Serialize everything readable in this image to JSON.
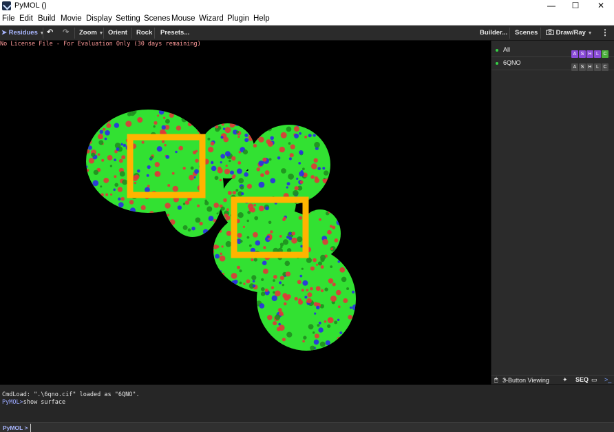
{
  "window": {
    "title": "PyMOL ()",
    "minimize": "—",
    "maximize": "☐",
    "close": "✕"
  },
  "menu": [
    "File",
    "Edit",
    "Build",
    "Movie",
    "Display",
    "Setting",
    "Scenes",
    "Mouse",
    "Wizard",
    "Plugin",
    "Help"
  ],
  "toolbar": {
    "selector_label": "Residues",
    "zoom_label": "Zoom",
    "orient_label": "Orient",
    "rock_label": "Rock",
    "presets_label": "Presets...",
    "builder_label": "Builder...",
    "scenes_label": "Scenes",
    "drawray_label": "Draw/Ray",
    "more_label": "⋮"
  },
  "viewport": {
    "license_text": "No License File - For Evaluation Only (30 days remaining)",
    "highlight_color": "#ffb400"
  },
  "objects": [
    {
      "name": "All",
      "buttons": [
        "A",
        "S",
        "H",
        "L",
        "C"
      ],
      "colored": true
    },
    {
      "name": "6QNO",
      "buttons": [
        "A",
        "S",
        "H",
        "L",
        "C"
      ],
      "colored": false
    }
  ],
  "status": {
    "mouse_mode": "3-Button Viewing",
    "seq_label": "SEQ"
  },
  "console": {
    "line1": " CmdLoad: \".\\6qno.cif\" loaded as \"6QNO\".",
    "line2_prompt": "PyMOL>",
    "line2_cmd": "show surface"
  },
  "command": {
    "prompt": "PyMOL >",
    "value": ""
  },
  "colors": {
    "carbon": "#32e132",
    "oxygen": "#e03838",
    "nitrogen": "#2a2ee6"
  }
}
